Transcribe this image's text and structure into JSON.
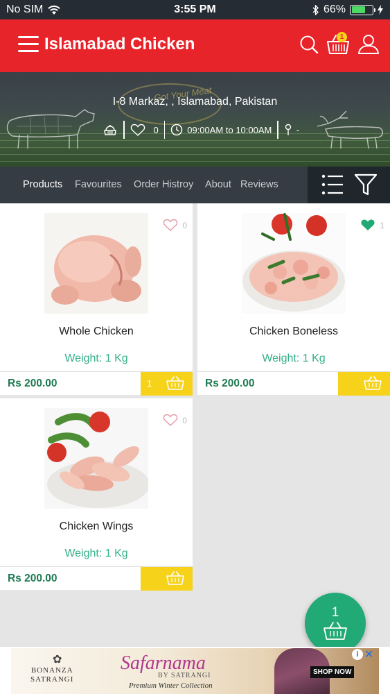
{
  "status_bar": {
    "carrier": "No SIM",
    "time": "3:55 PM",
    "battery_text": "66%",
    "battery_level": 0.66,
    "icons": [
      "wifi-icon",
      "bluetooth-icon",
      "battery-icon",
      "charging-icon"
    ]
  },
  "header": {
    "title": "Islamabad Chicken",
    "cart_badge": "1",
    "brand_color": "#e8242b",
    "icons": [
      "menu-icon",
      "search-icon",
      "cart-icon",
      "user-icon"
    ]
  },
  "banner": {
    "address": "I-8 Markaz, , Islamabad, Pakistan",
    "favourites_count": "0",
    "timing": "09:00AM to 10:00AM",
    "extra": "-",
    "logo_text": "Got Your Meat"
  },
  "tabs": {
    "items": [
      {
        "label": "Products",
        "active": true
      },
      {
        "label": "Favourites",
        "active": false
      },
      {
        "label": "Order Histroy",
        "active": false
      },
      {
        "label": "About",
        "active": false
      },
      {
        "label": "Reviews",
        "active": false
      }
    ]
  },
  "products": [
    {
      "name": "Whole Chicken",
      "weight": "Weight: 1 Kg",
      "price": "Rs 200.00",
      "favourites": "0",
      "favourited": false,
      "in_cart": "1"
    },
    {
      "name": "Chicken Boneless",
      "weight": "Weight: 1 Kg",
      "price": "Rs 200.00",
      "favourites": "1",
      "favourited": true,
      "in_cart": ""
    },
    {
      "name": "Chicken Wings",
      "weight": "Weight: 1 Kg",
      "price": "Rs 200.00",
      "favourites": "0",
      "favourited": false,
      "in_cart": ""
    }
  ],
  "fab": {
    "count": "1"
  },
  "ad": {
    "brand_line1": "BONANZA",
    "brand_line2": "SATRANGI",
    "headline": "Safarnama",
    "by_line": "BY SATRANGI",
    "subline": "Premium Winter Collection",
    "cta": "SHOP NOW"
  },
  "colors": {
    "accent_green": "#21a976",
    "price_green": "#1f7a52",
    "add_button_yellow": "#f6d21b",
    "tab_bar": "#353c44"
  }
}
